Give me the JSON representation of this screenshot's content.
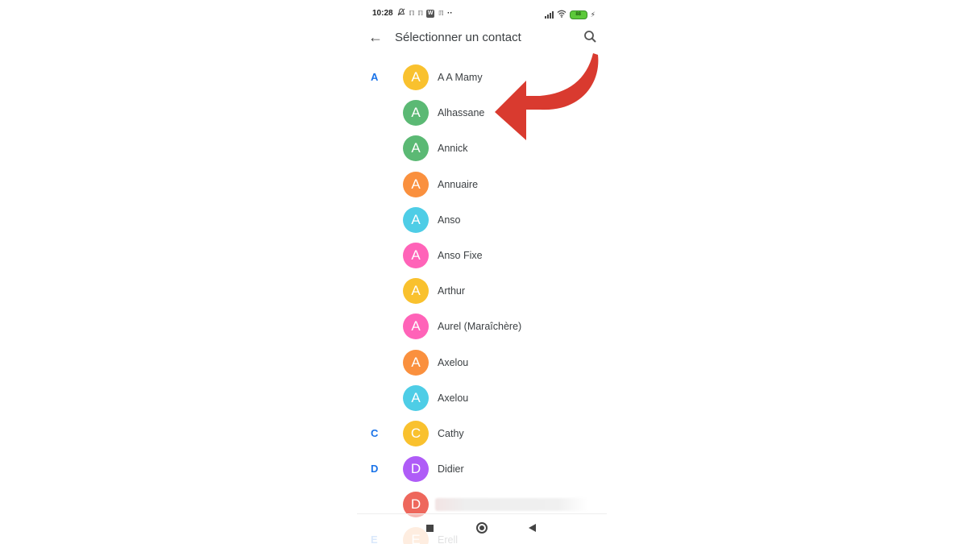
{
  "status_bar": {
    "time": "10:28",
    "left_icons": [
      "alarm-off-icon",
      "notification-icon",
      "notification-icon",
      "w-app-icon",
      "notification-icon",
      "more-dots-icon"
    ],
    "w_badge": "W",
    "small_glyph": "ℿ",
    "dots": "··",
    "battery_level": "88",
    "charging_glyph": "⚡"
  },
  "app_bar": {
    "back_glyph": "←",
    "title": "Sélectionner un contact"
  },
  "contacts": [
    {
      "section": "A",
      "initial": "A",
      "name": "A A Mamy",
      "color": "#f9c12e"
    },
    {
      "section": "",
      "initial": "A",
      "name": "Alhassane",
      "color": "#5bb974"
    },
    {
      "section": "",
      "initial": "A",
      "name": "Annick",
      "color": "#5bb974"
    },
    {
      "section": "",
      "initial": "A",
      "name": "Annuaire",
      "color": "#fa903e"
    },
    {
      "section": "",
      "initial": "A",
      "name": "Anso",
      "color": "#4ecde6"
    },
    {
      "section": "",
      "initial": "A",
      "name": "Anso Fixe",
      "color": "#ff63b8"
    },
    {
      "section": "",
      "initial": "A",
      "name": "Arthur",
      "color": "#f9c12e"
    },
    {
      "section": "",
      "initial": "A",
      "name": "Aurel (Maraîchère)",
      "color": "#ff63b8"
    },
    {
      "section": "",
      "initial": "A",
      "name": "Axelou",
      "color": "#fa903e"
    },
    {
      "section": "",
      "initial": "A",
      "name": "Axelou",
      "color": "#4ecde6"
    },
    {
      "section": "C",
      "initial": "C",
      "name": "Cathy",
      "color": "#f9c12e"
    },
    {
      "section": "D",
      "initial": "D",
      "name": "Didier",
      "color": "#af5cf7"
    },
    {
      "section": "",
      "initial": "D",
      "name": "",
      "color": "#ee675c",
      "blurred": true
    },
    {
      "section": "E",
      "initial": "E",
      "name": "Erell",
      "color": "#fa903e",
      "faded": true
    }
  ],
  "annotation": {
    "arrow_color": "#d93a2f",
    "points_to": "Alhassane"
  },
  "nav_bar": {
    "buttons": [
      "recents-button",
      "home-button",
      "back-button"
    ]
  }
}
